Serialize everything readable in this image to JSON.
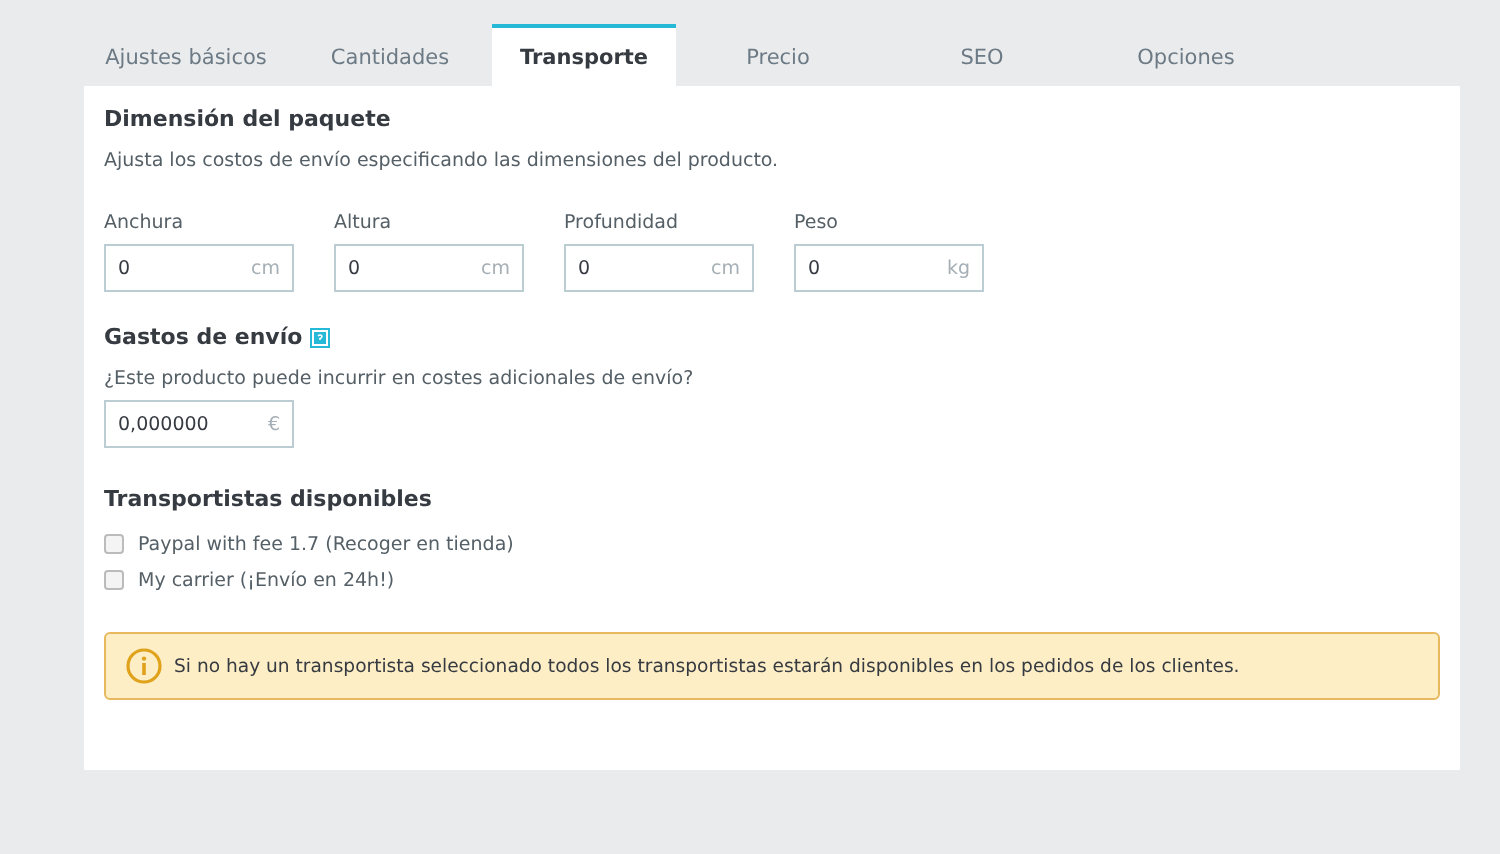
{
  "tabs": [
    {
      "label": "Ajustes básicos",
      "selected": false
    },
    {
      "label": "Cantidades",
      "selected": false
    },
    {
      "label": "Transporte",
      "selected": true
    },
    {
      "label": "Precio",
      "selected": false
    },
    {
      "label": "SEO",
      "selected": false
    },
    {
      "label": "Opciones",
      "selected": false
    }
  ],
  "package": {
    "title": "Dimensión del paquete",
    "description": "Ajusta los costos de envío especificando las dimensiones del producto.",
    "fields": [
      {
        "label": "Anchura",
        "value": "0",
        "unit": "cm"
      },
      {
        "label": "Altura",
        "value": "0",
        "unit": "cm"
      },
      {
        "label": "Profundidad",
        "value": "0",
        "unit": "cm"
      },
      {
        "label": "Peso",
        "value": "0",
        "unit": "kg"
      }
    ]
  },
  "shipping": {
    "title": "Gastos de envío",
    "question": "¿Este producto puede incurrir en costes adicionales de envío?",
    "value": "0,000000",
    "unit": "€"
  },
  "carriers": {
    "title": "Transportistas disponibles",
    "items": [
      {
        "label": "Paypal with fee 1.7 (Recoger en tienda)",
        "checked": false
      },
      {
        "label": "My carrier (¡Envío en 24h!)",
        "checked": false
      }
    ]
  },
  "alert": "Si no hay un transportista seleccionado todos los transportistas estarán disponibles en los pedidos de los clientes."
}
